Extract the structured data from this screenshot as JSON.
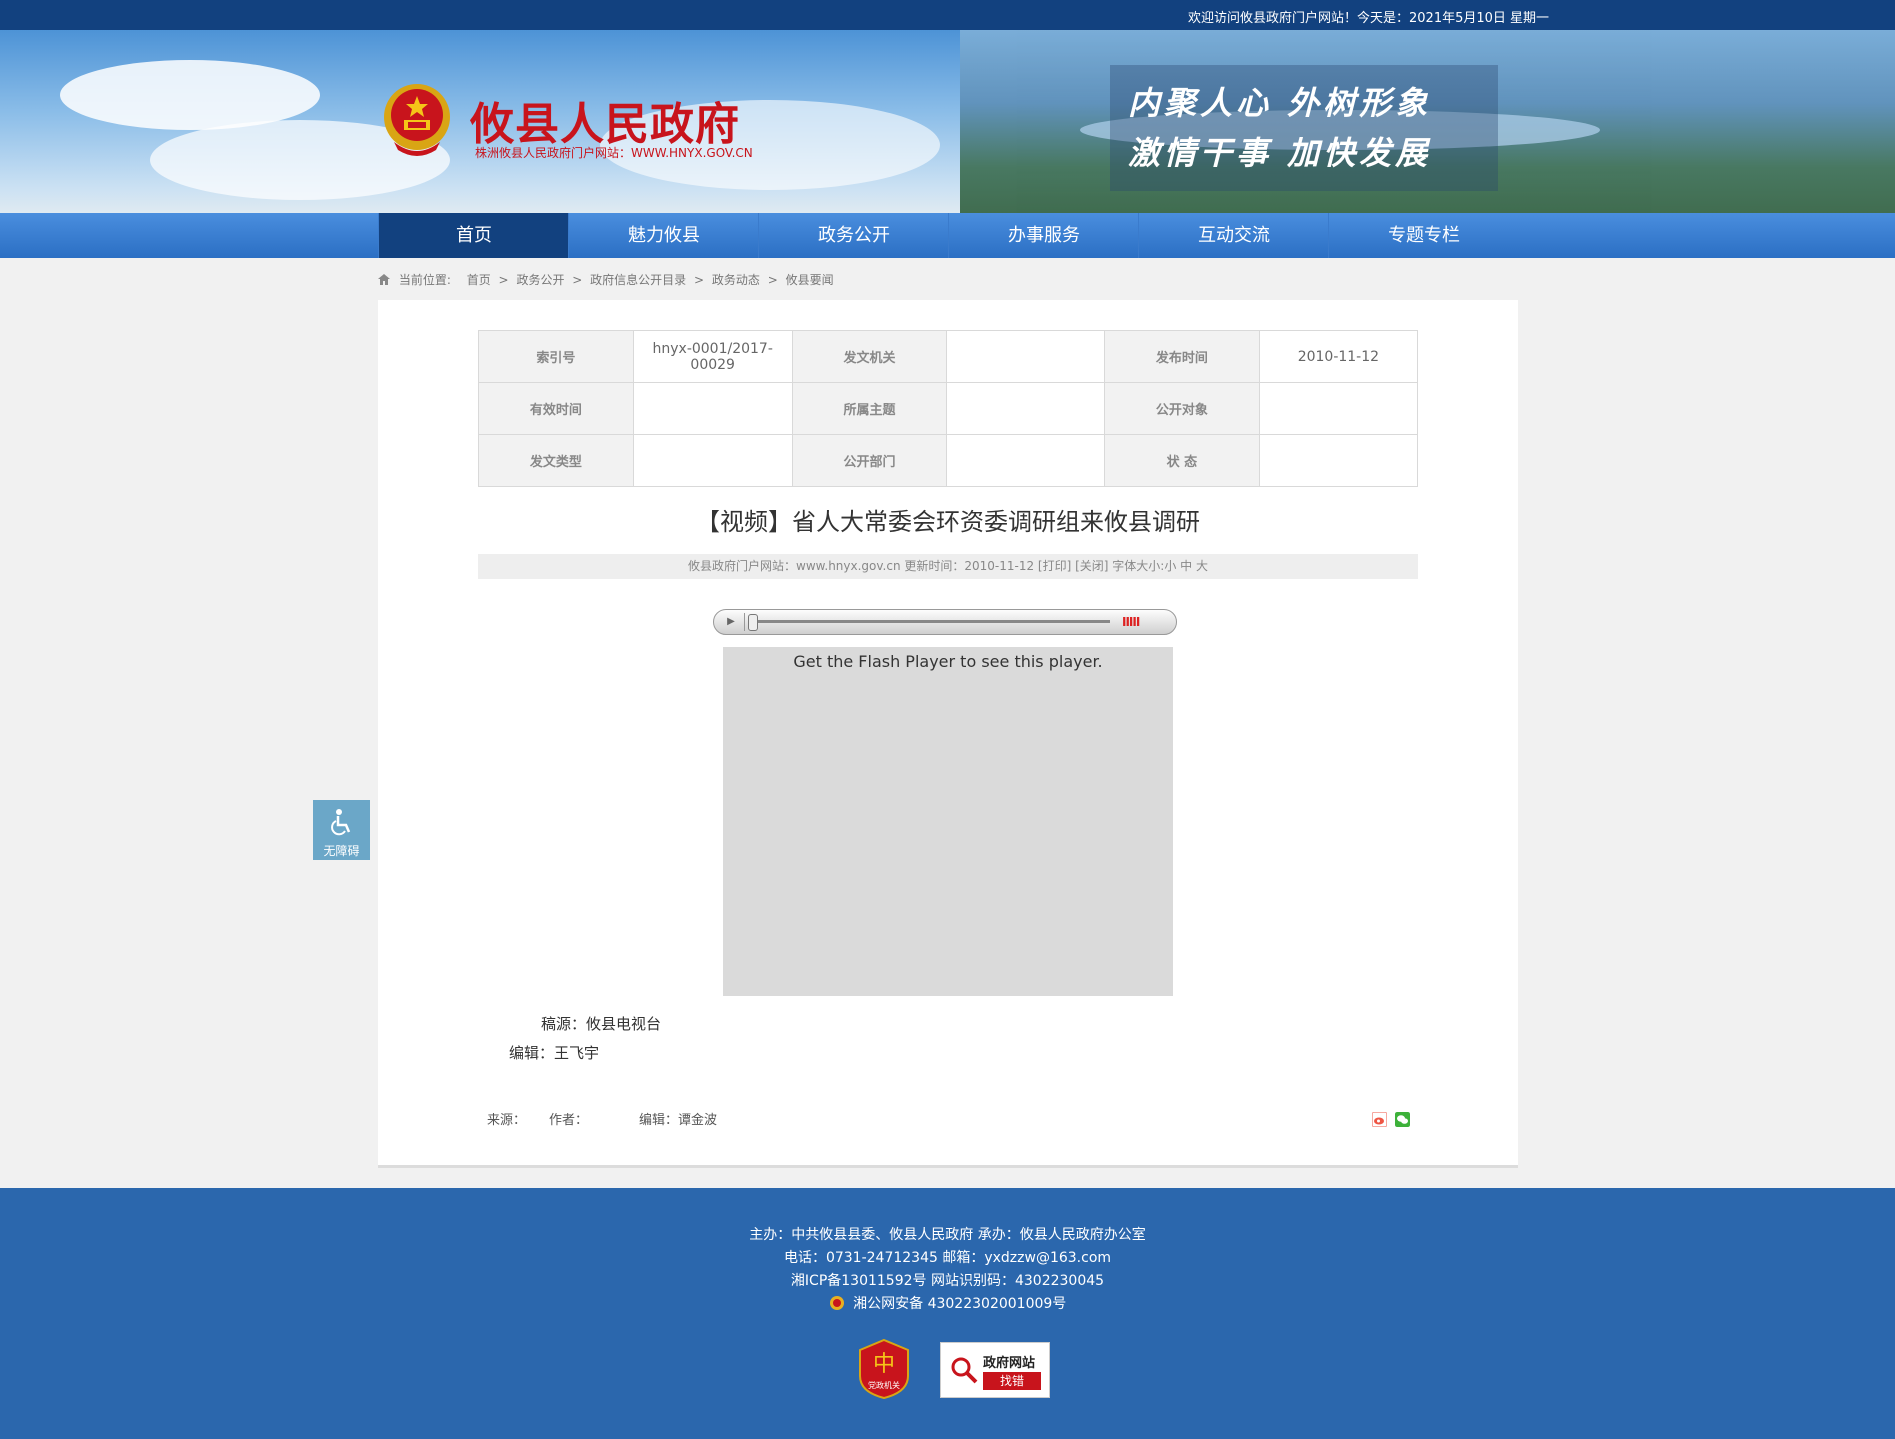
{
  "topbar": {
    "welcome": "欢迎访问攸县政府门户网站！今天是：2021年5月10日 星期一"
  },
  "header": {
    "site_title": "攸县人民政府",
    "site_subtitle": "株洲攸县人民政府门户网站：WWW.HNYX.GOV.CN",
    "slogan_line1": "内聚人心  外树形象",
    "slogan_line2": "激情干事  加快发展"
  },
  "nav": {
    "items": [
      {
        "label": "首页",
        "active": true
      },
      {
        "label": "魅力攸县"
      },
      {
        "label": "政务公开"
      },
      {
        "label": "办事服务"
      },
      {
        "label": "互动交流"
      },
      {
        "label": "专题专栏"
      }
    ]
  },
  "breadcrumb": {
    "prefix": "当前位置:",
    "items": [
      "首页",
      "政务公开",
      "政府信息公开目录",
      "政务动态",
      "攸县要闻"
    ],
    "separator": ">"
  },
  "meta_table": {
    "rows": [
      [
        {
          "k": "索引号",
          "v": "hnyx-0001/2017-00029"
        },
        {
          "k": "发文机关",
          "v": ""
        },
        {
          "k": "发布时间",
          "v": "2010-11-12"
        }
      ],
      [
        {
          "k": "有效时间",
          "v": ""
        },
        {
          "k": "所属主题",
          "v": ""
        },
        {
          "k": "公开对象",
          "v": ""
        }
      ],
      [
        {
          "k": "发文类型",
          "v": ""
        },
        {
          "k": "公开部门",
          "v": ""
        },
        {
          "k": "状 态",
          "v": ""
        }
      ]
    ]
  },
  "article": {
    "title": "【视频】省人大常委会环资委调研组来攸县调研",
    "info_bar": "攸县政府门户网站：www.hnyx.gov.cn   更新时间：2010-11-12   [打印]  [关闭]   字体大小:小 中 大",
    "flash_message": "Get the Flash Player to see this player.",
    "source_line": "稿源：攸县电视台",
    "editor_line": "编辑：王飞宇",
    "footer_source": "来源：",
    "footer_author": "作者：",
    "footer_editor": "编辑：谭金波"
  },
  "accessibility": {
    "label": "无障碍"
  },
  "footer": {
    "line1": "主办：中共攸县县委、攸县人民政府 承办：攸县人民政府办公室",
    "line2": "电话：0731-24712345 邮箱：yxdzzw@163.com",
    "line3": "湘ICP备13011592号   网站识别码：4302230045",
    "line4": "湘公网安备 43022302001009号",
    "badge1_text": "党政机关",
    "badge2_line1": "政府网站",
    "badge2_line2": "找错"
  },
  "colors": {
    "nav_active": "#12417f",
    "title_red": "#c8141c",
    "footer_blue": "#2b67ad",
    "accessibility_blue": "#6ba7c8"
  }
}
